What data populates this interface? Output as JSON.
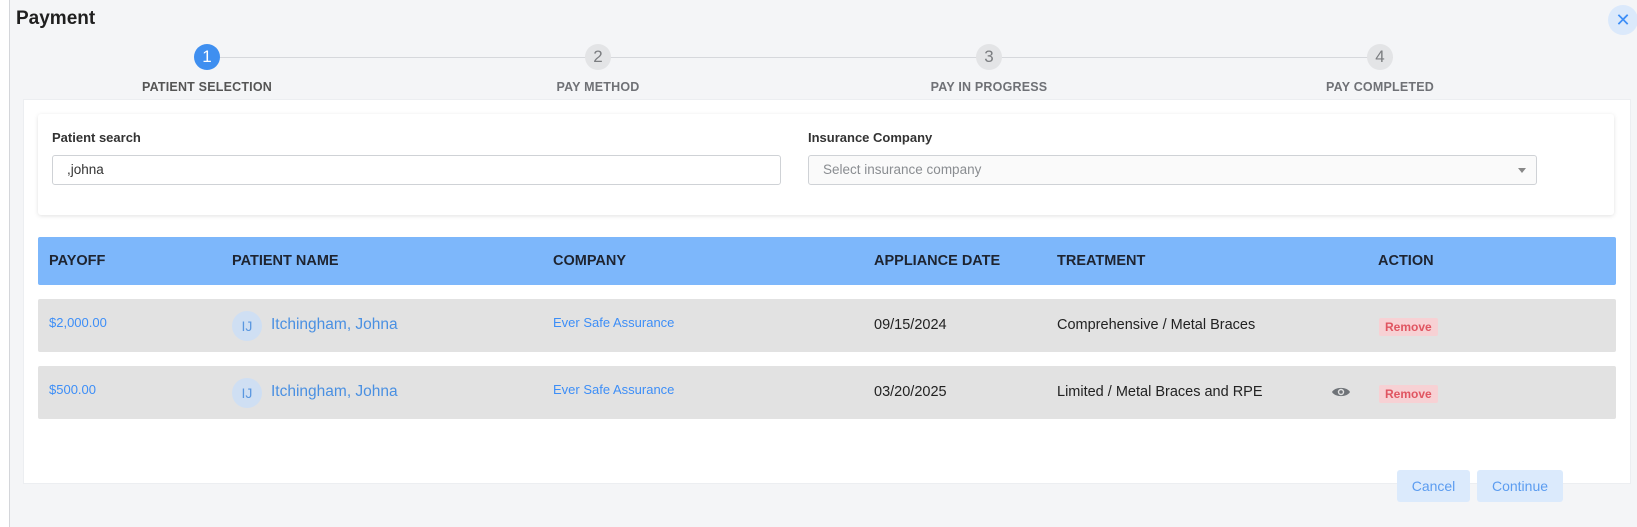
{
  "dialog": {
    "title": "Payment"
  },
  "steps": [
    {
      "number": "1",
      "label": "PATIENT SELECTION"
    },
    {
      "number": "2",
      "label": "PAY METHOD"
    },
    {
      "number": "3",
      "label": "PAY IN PROGRESS"
    },
    {
      "number": "4",
      "label": "PAY COMPLETED"
    }
  ],
  "search": {
    "patient_label": "Patient search",
    "patient_value": ",johna",
    "insurance_label": "Insurance Company",
    "insurance_placeholder": "Select insurance company"
  },
  "table": {
    "headers": [
      "PAYOFF",
      "PATIENT NAME",
      "COMPANY",
      "APPLIANCE DATE",
      "TREATMENT",
      "ACTION"
    ],
    "rows": [
      {
        "payoff": "$2,000.00",
        "initials": "IJ",
        "patient": "Itchingham, Johna",
        "company": "Ever Safe Assurance",
        "date": "09/15/2024",
        "treatment": "Comprehensive / Metal Braces",
        "action": "Remove"
      },
      {
        "payoff": "$500.00",
        "initials": "IJ",
        "patient": "Itchingham, Johna",
        "company": "Ever Safe Assurance",
        "date": "03/20/2025",
        "treatment": "Limited / Metal Braces and RPE",
        "action": "Remove"
      }
    ]
  },
  "footer": {
    "cancel_label": "Cancel",
    "continue_label": "Continue"
  },
  "icons": {
    "close": "close-icon",
    "view": "eye-icon",
    "dropdown": "chevron-down-icon"
  },
  "colors": {
    "accent": "#3f8ff0",
    "header_bg": "#7db7fb",
    "remove": "#e05561"
  }
}
